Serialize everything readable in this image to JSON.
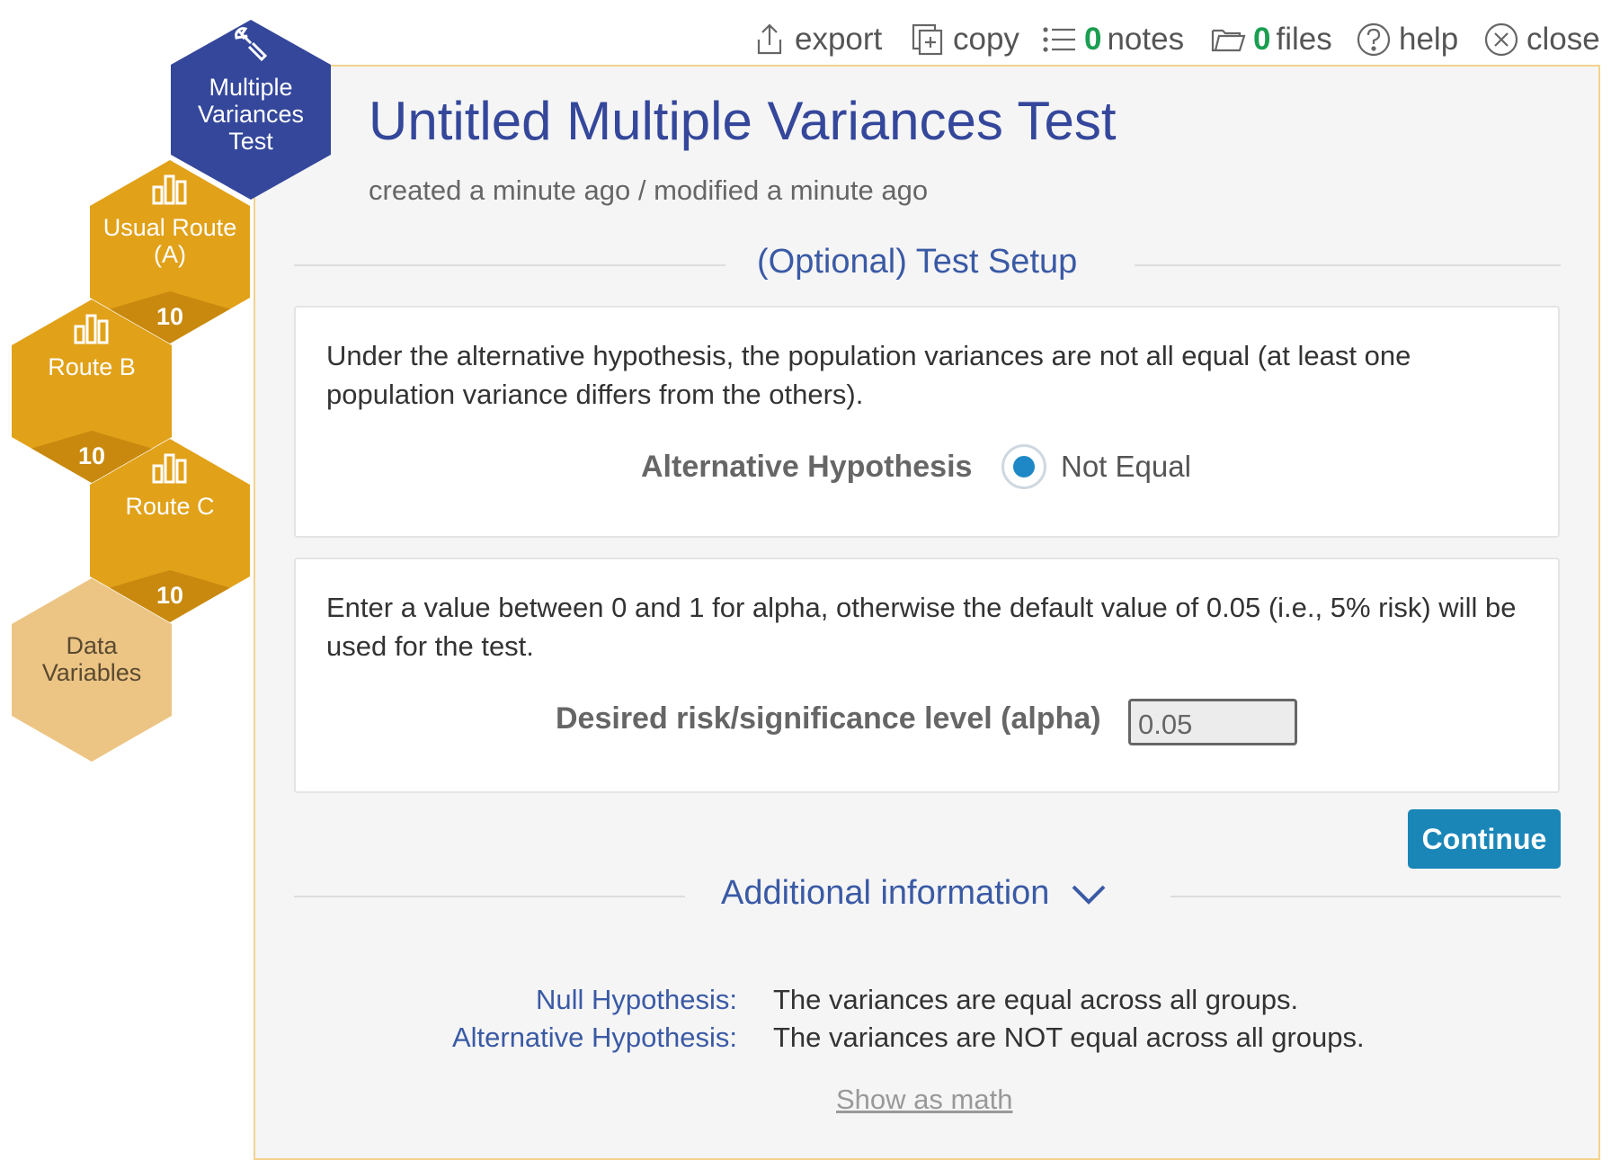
{
  "toolbar": {
    "export_label": "export",
    "copy_label": "copy",
    "notes_count": "0",
    "notes_label": "notes",
    "files_count": "0",
    "files_label": "files",
    "help_label": "help",
    "close_label": "close"
  },
  "hexes": {
    "test": {
      "line1": "Multiple",
      "line2": "Variances",
      "line3": "Test",
      "icon": "wrench-icon"
    },
    "usual_route": {
      "line1": "Usual Route",
      "line2": "(A)",
      "count": "10",
      "icon": "bar-chart-icon"
    },
    "route_b": {
      "line1": "Route B",
      "count": "10",
      "icon": "bar-chart-icon"
    },
    "route_c": {
      "line1": "Route C",
      "count": "10",
      "icon": "bar-chart-icon"
    },
    "data_variables": {
      "line1": "Data",
      "line2": "Variables"
    }
  },
  "document": {
    "title": "Untitled Multiple Variances Test",
    "meta": "created a minute ago / modified a minute ago"
  },
  "test_setup": {
    "section_title": "(Optional) Test Setup",
    "hypothesis_description": "Under the alternative hypothesis, the population variances are not all equal (at least one population variance differs from the others).",
    "alt_hypothesis_label": "Alternative Hypothesis",
    "alt_hypothesis_option": "Not Equal",
    "alpha_description": "Enter a value between 0 and 1 for alpha, otherwise the default value of 0.05 (i.e., 5% risk) will be used for the test.",
    "alpha_label": "Desired risk/significance level (alpha)",
    "alpha_value": "0.05",
    "continue_label": "Continue"
  },
  "additional_info": {
    "section_title": "Additional information",
    "null_label": "Null Hypothesis:",
    "null_text": "The variances are equal across all groups.",
    "alt_label": "Alternative Hypothesis:",
    "alt_text": "The variances are NOT equal across all groups.",
    "show_math_label": "Show as math"
  },
  "colors": {
    "accent_blue": "#34479b",
    "gold": "#e6a31a",
    "tan": "#ecc585",
    "button": "#1a86b8",
    "count_green": "#1a9e50"
  }
}
